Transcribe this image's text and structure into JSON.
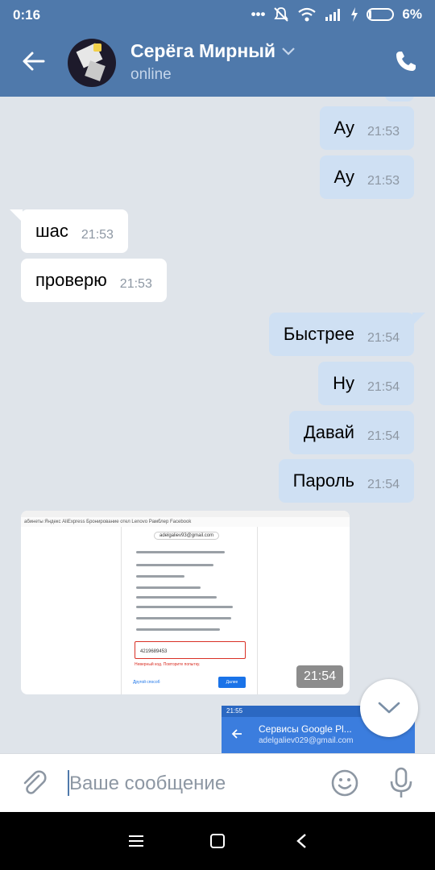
{
  "status_bar": {
    "time": "0:16",
    "icons": [
      "more-icon",
      "mute-icon",
      "wifi-icon",
      "signal-icon",
      "charging-icon"
    ],
    "battery": "6%"
  },
  "header": {
    "contact_name": "Серёга Мирный",
    "presence": "online",
    "accent": "#4f79ab"
  },
  "messages": [
    {
      "dir": "out",
      "text": "Ау",
      "time": "21:53"
    },
    {
      "dir": "out",
      "text": "Ау",
      "time": "21:53"
    },
    {
      "dir": "in",
      "text": "шас",
      "time": "21:53"
    },
    {
      "dir": "in",
      "text": "проверю",
      "time": "21:53"
    },
    {
      "dir": "out",
      "text": "Быстрее",
      "time": "21:54"
    },
    {
      "dir": "out",
      "text": "Ну",
      "time": "21:54"
    },
    {
      "dir": "out",
      "text": "Давай",
      "time": "21:54"
    },
    {
      "dir": "out",
      "text": "Пароль",
      "time": "21:54"
    }
  ],
  "photo_message": {
    "time": "21:54",
    "screenshot": {
      "bookmarks": "абинеты   Яндекс   AliExpress   Бронирование отел   Lenovo   Рамблер   Facebook",
      "email": "adelgaliev93@gmail.com",
      "code": "4219689453",
      "error": "Неверный код. Повторите попытку.",
      "other_way": "Другой способ",
      "next": "Далее"
    }
  },
  "preview_message": {
    "status_time": "21:55",
    "title": "Сервисы Google Pl...",
    "subtitle": "adelgaliev029@gmail.com"
  },
  "composer": {
    "placeholder": "Ваше сообщение"
  }
}
